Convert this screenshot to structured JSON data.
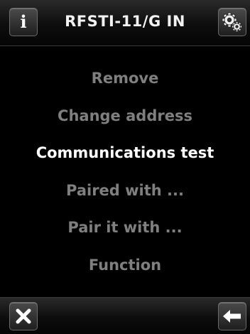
{
  "header": {
    "title": "RFSTI-11/G IN",
    "info_icon": "info-icon",
    "settings_icon": "gears-icon"
  },
  "menu": {
    "items": [
      {
        "label": "Remove",
        "active": false
      },
      {
        "label": "Change address",
        "active": false
      },
      {
        "label": "Communications test",
        "active": true
      },
      {
        "label": "Paired with ...",
        "active": false
      },
      {
        "label": "Pair it with ...",
        "active": false
      },
      {
        "label": "Function",
        "active": false
      }
    ]
  },
  "footer": {
    "close_icon": "close-icon",
    "back_icon": "back-arrow-icon"
  },
  "colors": {
    "background": "#000000",
    "active_text": "#ffffff",
    "inactive_text": "#7f7f7f"
  }
}
